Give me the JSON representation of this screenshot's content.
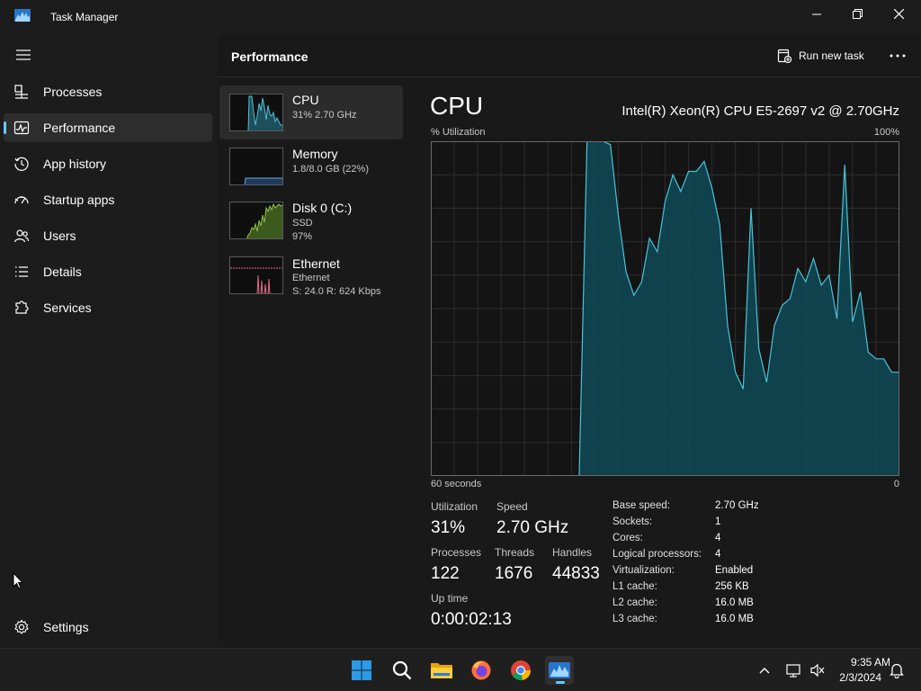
{
  "window": {
    "title": "Task Manager"
  },
  "nav": {
    "items": [
      {
        "label": "Processes"
      },
      {
        "label": "Performance"
      },
      {
        "label": "App history"
      },
      {
        "label": "Startup apps"
      },
      {
        "label": "Users"
      },
      {
        "label": "Details"
      },
      {
        "label": "Services"
      }
    ],
    "settings_label": "Settings"
  },
  "header": {
    "title": "Performance",
    "run_new_task": "Run new task"
  },
  "resources": [
    {
      "name": "CPU",
      "line1": "31% 2.70 GHz",
      "line2": ""
    },
    {
      "name": "Memory",
      "line1": "1.8/8.0 GB (22%)",
      "line2": ""
    },
    {
      "name": "Disk 0 (C:)",
      "line1": "SSD",
      "line2": "97%"
    },
    {
      "name": "Ethernet",
      "line1": "Ethernet",
      "line2": "S: 24.0  R: 624 Kbps"
    }
  ],
  "detail": {
    "title": "CPU",
    "model": "Intel(R) Xeon(R) CPU E5-2697 v2 @ 2.70GHz",
    "util_label": "% Utilization",
    "util_max": "100%",
    "time_left": "60 seconds",
    "time_right": "0",
    "stats": {
      "utilization_label": "Utilization",
      "utilization": "31%",
      "speed_label": "Speed",
      "speed": "2.70 GHz",
      "processes_label": "Processes",
      "processes": "122",
      "threads_label": "Threads",
      "threads": "1676",
      "handles_label": "Handles",
      "handles": "44833",
      "uptime_label": "Up time",
      "uptime": "0:00:02:13"
    },
    "info": [
      {
        "key": "Base speed:",
        "value": "2.70 GHz"
      },
      {
        "key": "Sockets:",
        "value": "1"
      },
      {
        "key": "Cores:",
        "value": "4"
      },
      {
        "key": "Logical processors:",
        "value": "4"
      },
      {
        "key": "Virtualization:",
        "value": "Enabled"
      },
      {
        "key": "L1 cache:",
        "value": "256 KB"
      },
      {
        "key": "L2 cache:",
        "value": "16.0 MB"
      },
      {
        "key": "L3 cache:",
        "value": "16.0 MB"
      }
    ]
  },
  "chart_data": {
    "type": "area",
    "ylabel": "% Utilization",
    "ylim": [
      0,
      100
    ],
    "xlim": [
      60,
      0
    ],
    "x": [
      60,
      59,
      58,
      57,
      56,
      55,
      54,
      53,
      52,
      51,
      50,
      49,
      48,
      47,
      46,
      45,
      44,
      43,
      42,
      41,
      40,
      39,
      38,
      37,
      36,
      35,
      34,
      33,
      32,
      31,
      30,
      29,
      28,
      27,
      26,
      25,
      24,
      23,
      22,
      21,
      20,
      19,
      18,
      17,
      16,
      15,
      14,
      13,
      12,
      11,
      10,
      9,
      8,
      7,
      6,
      5,
      4,
      3,
      2,
      1,
      0
    ],
    "series": [
      {
        "color": "#4cc2d6",
        "values": [
          0,
          0,
          0,
          0,
          0,
          0,
          0,
          0,
          0,
          0,
          0,
          0,
          0,
          0,
          0,
          0,
          0,
          0,
          0,
          0,
          100,
          100,
          100,
          99,
          78,
          61,
          54,
          58,
          71,
          67,
          82,
          90,
          85,
          91,
          91,
          94,
          86,
          75,
          45,
          31,
          26,
          80,
          38,
          28,
          45,
          51,
          53,
          62,
          58,
          65,
          57,
          60,
          47,
          93,
          46,
          55,
          37,
          35,
          35,
          31,
          31
        ]
      }
    ],
    "grid": true
  },
  "taskbar": {
    "clock_time": "9:35 AM",
    "clock_date": "2/3/2024",
    "icons": [
      "start-icon",
      "search-icon",
      "file-explorer-icon",
      "firefox-icon",
      "chrome-icon",
      "task-manager-icon"
    ]
  },
  "colors": {
    "accent": "#60cdff",
    "cpu_graph": "#4cc2d6",
    "memory_graph": "#6aa6e0",
    "disk_graph": "#8bc34a",
    "ethernet_graph": "#e06c8c"
  }
}
